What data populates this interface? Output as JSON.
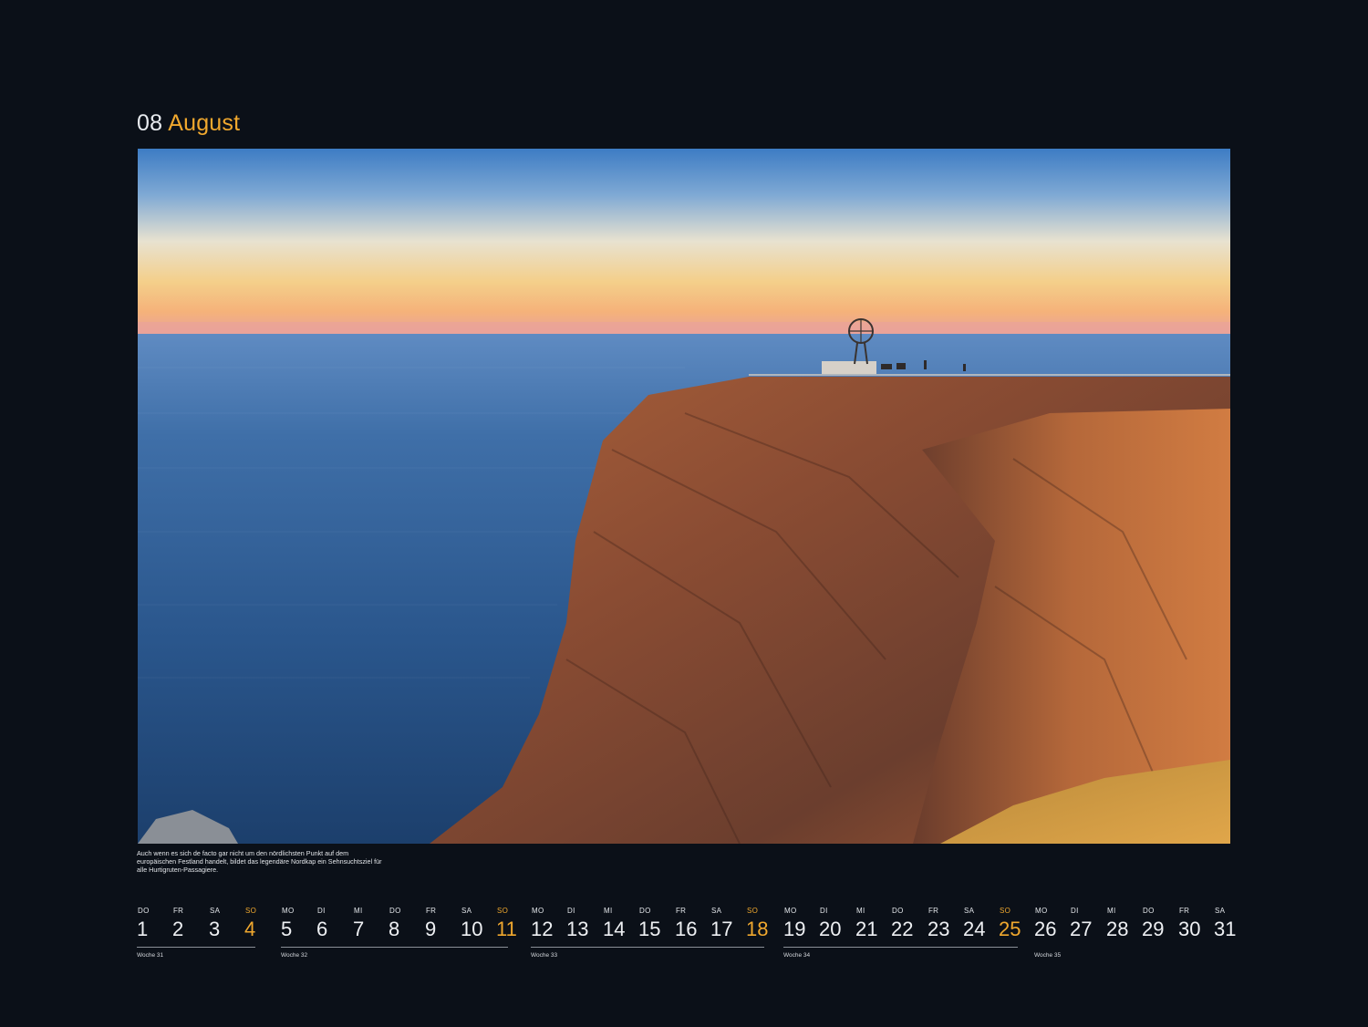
{
  "colors": {
    "background": "#0b1018",
    "accent": "#f0a82e",
    "text": "#e6e8ec"
  },
  "header": {
    "month_number": "08",
    "month_name": "August"
  },
  "photo": {
    "subject": "cliff-with-globe-monument-over-sea"
  },
  "caption": "Auch wenn es sich de facto gar nicht um den nördlichsten Punkt auf dem europäischen Festland handelt, bildet das legendäre Nordkap ein Sehnsuchtsziel für alle Hurtigruten-Passagiere.",
  "weeks": [
    {
      "label": "Woche 31",
      "days": [
        {
          "wd": "DO",
          "d": "1"
        },
        {
          "wd": "FR",
          "d": "2"
        },
        {
          "wd": "SA",
          "d": "3"
        },
        {
          "wd": "SO",
          "d": "4"
        }
      ]
    },
    {
      "label": "Woche 32",
      "days": [
        {
          "wd": "MO",
          "d": "5"
        },
        {
          "wd": "DI",
          "d": "6"
        },
        {
          "wd": "MI",
          "d": "7"
        },
        {
          "wd": "DO",
          "d": "8"
        },
        {
          "wd": "FR",
          "d": "9"
        },
        {
          "wd": "SA",
          "d": "10"
        },
        {
          "wd": "SO",
          "d": "11"
        }
      ]
    },
    {
      "label": "Woche 33",
      "days": [
        {
          "wd": "MO",
          "d": "12"
        },
        {
          "wd": "DI",
          "d": "13"
        },
        {
          "wd": "MI",
          "d": "14"
        },
        {
          "wd": "DO",
          "d": "15"
        },
        {
          "wd": "FR",
          "d": "16"
        },
        {
          "wd": "SA",
          "d": "17"
        },
        {
          "wd": "SO",
          "d": "18"
        }
      ]
    },
    {
      "label": "Woche 34",
      "days": [
        {
          "wd": "MO",
          "d": "19"
        },
        {
          "wd": "DI",
          "d": "20"
        },
        {
          "wd": "MI",
          "d": "21"
        },
        {
          "wd": "DO",
          "d": "22"
        },
        {
          "wd": "FR",
          "d": "23"
        },
        {
          "wd": "SA",
          "d": "24"
        },
        {
          "wd": "SO",
          "d": "25"
        }
      ]
    },
    {
      "label": "Woche 35",
      "days": [
        {
          "wd": "MO",
          "d": "26"
        },
        {
          "wd": "DI",
          "d": "27"
        },
        {
          "wd": "MI",
          "d": "28"
        },
        {
          "wd": "DO",
          "d": "29"
        },
        {
          "wd": "FR",
          "d": "30"
        },
        {
          "wd": "SA",
          "d": "31"
        }
      ]
    }
  ]
}
